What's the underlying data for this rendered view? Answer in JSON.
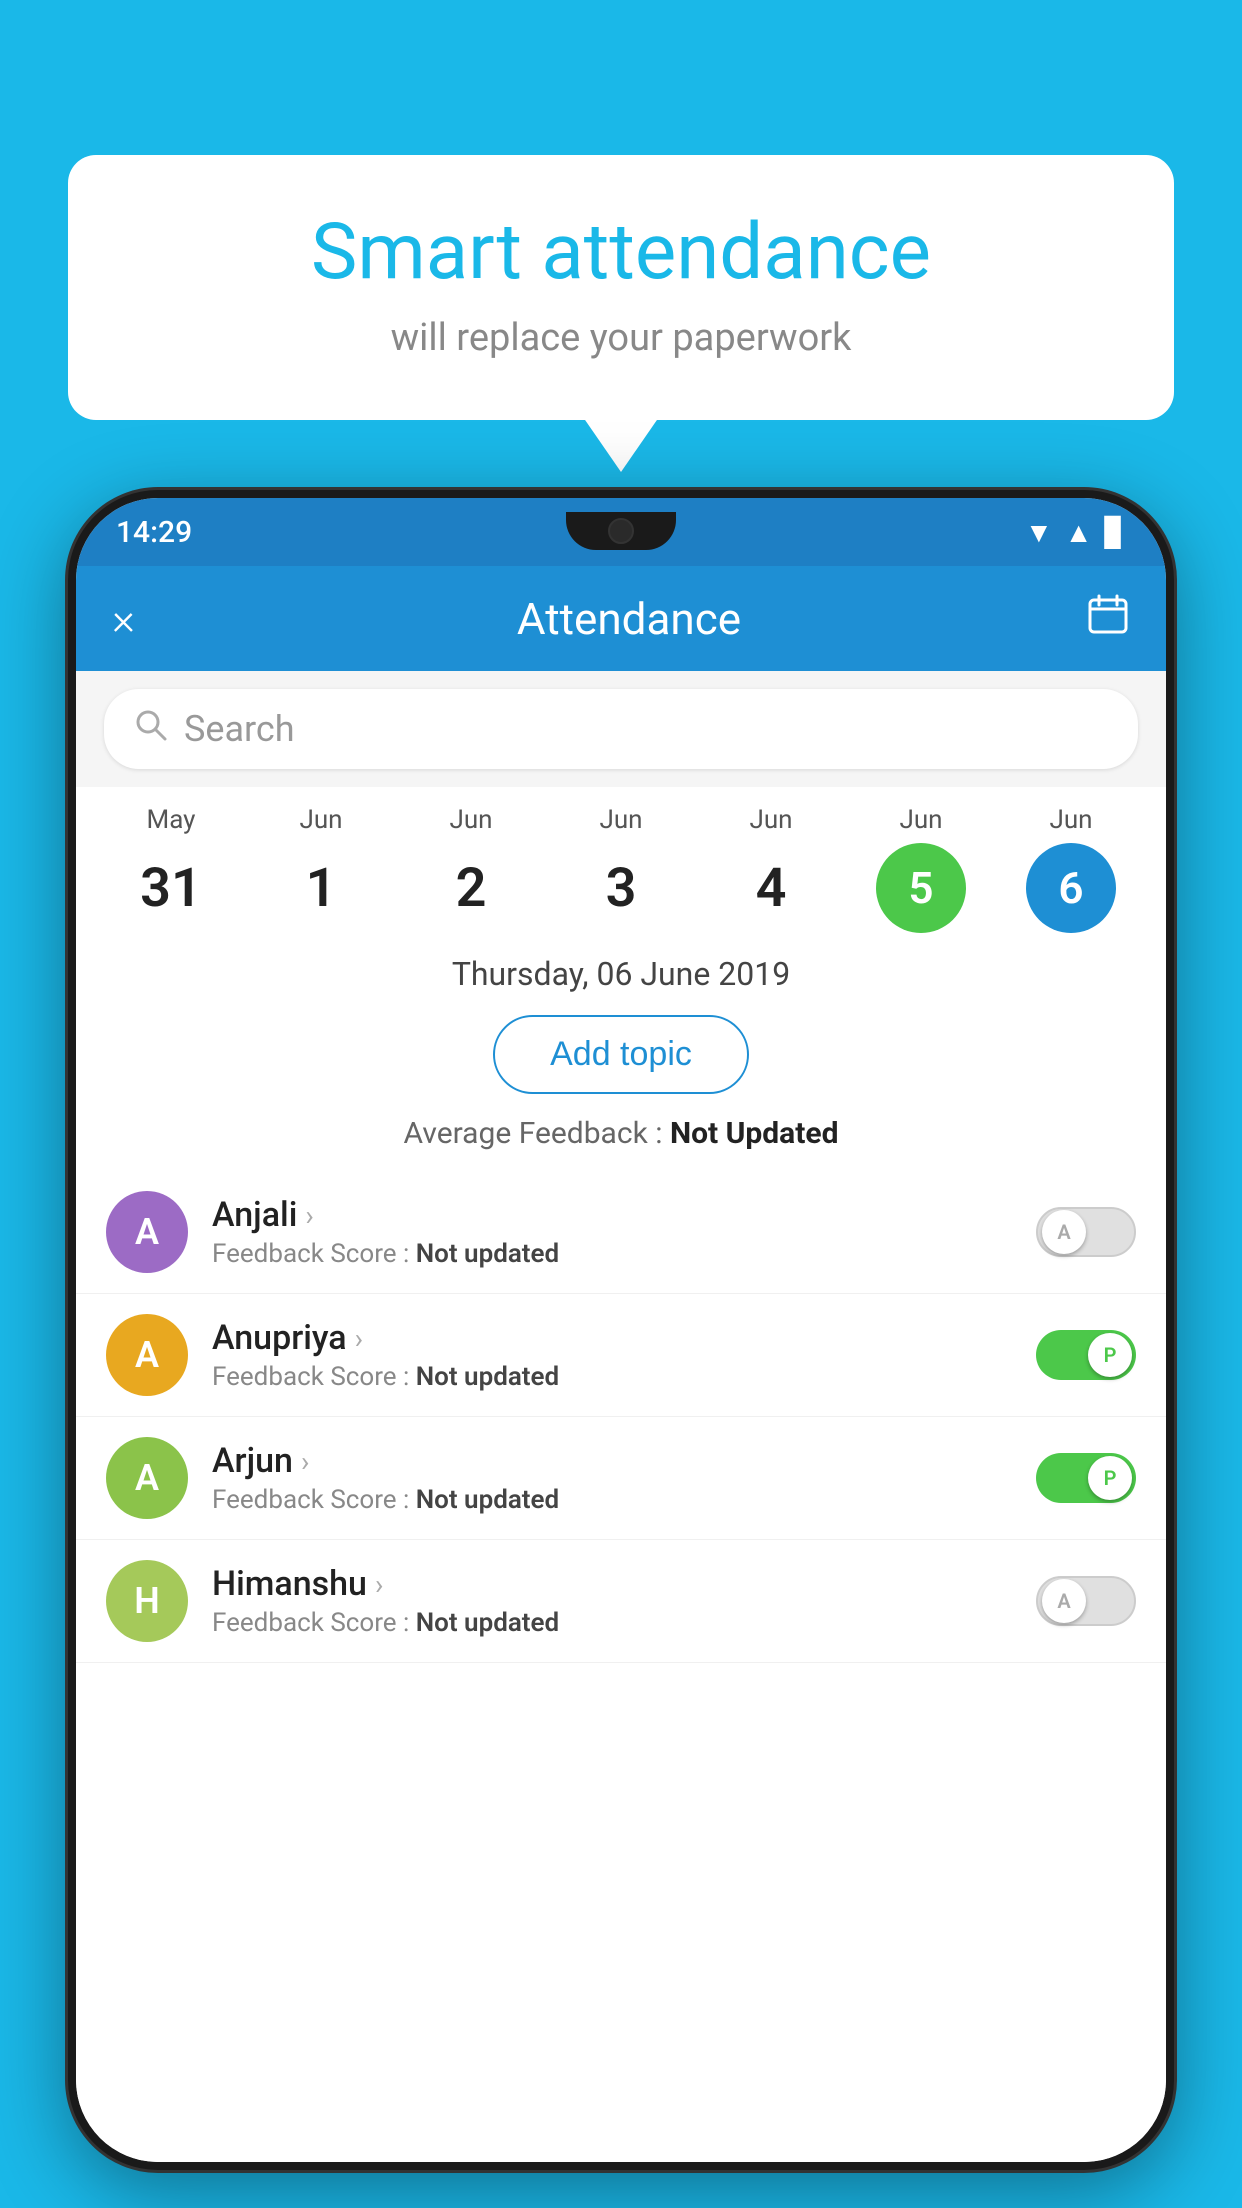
{
  "background_color": "#1ab8e8",
  "bubble": {
    "title": "Smart attendance",
    "subtitle": "will replace your paperwork"
  },
  "status_bar": {
    "time": "14:29",
    "wifi": "▼",
    "signal": "▲",
    "battery": "▌"
  },
  "app_bar": {
    "title": "Attendance",
    "close_label": "×",
    "calendar_label": "📅"
  },
  "search": {
    "placeholder": "Search"
  },
  "dates": [
    {
      "month": "May",
      "day": "31",
      "state": "normal"
    },
    {
      "month": "Jun",
      "day": "1",
      "state": "normal"
    },
    {
      "month": "Jun",
      "day": "2",
      "state": "normal"
    },
    {
      "month": "Jun",
      "day": "3",
      "state": "normal"
    },
    {
      "month": "Jun",
      "day": "4",
      "state": "normal"
    },
    {
      "month": "Jun",
      "day": "5",
      "state": "today"
    },
    {
      "month": "Jun",
      "day": "6",
      "state": "selected"
    }
  ],
  "selected_date_label": "Thursday, 06 June 2019",
  "add_topic_label": "Add topic",
  "average_feedback": {
    "label": "Average Feedback : ",
    "value": "Not Updated"
  },
  "students": [
    {
      "name": "Anjali",
      "avatar_letter": "A",
      "avatar_color": "#9c6bc5",
      "feedback_label": "Feedback Score : ",
      "feedback_value": "Not updated",
      "toggle_state": "off",
      "toggle_letter": "A"
    },
    {
      "name": "Anupriya",
      "avatar_letter": "A",
      "avatar_color": "#e8a820",
      "feedback_label": "Feedback Score : ",
      "feedback_value": "Not updated",
      "toggle_state": "on",
      "toggle_letter": "P"
    },
    {
      "name": "Arjun",
      "avatar_letter": "A",
      "avatar_color": "#8bc34a",
      "feedback_label": "Feedback Score : ",
      "feedback_value": "Not updated",
      "toggle_state": "on",
      "toggle_letter": "P"
    },
    {
      "name": "Himanshu",
      "avatar_letter": "H",
      "avatar_color": "#a5c95a",
      "feedback_label": "Feedback Score : ",
      "feedback_value": "Not updated",
      "toggle_state": "off",
      "toggle_letter": "A"
    }
  ]
}
